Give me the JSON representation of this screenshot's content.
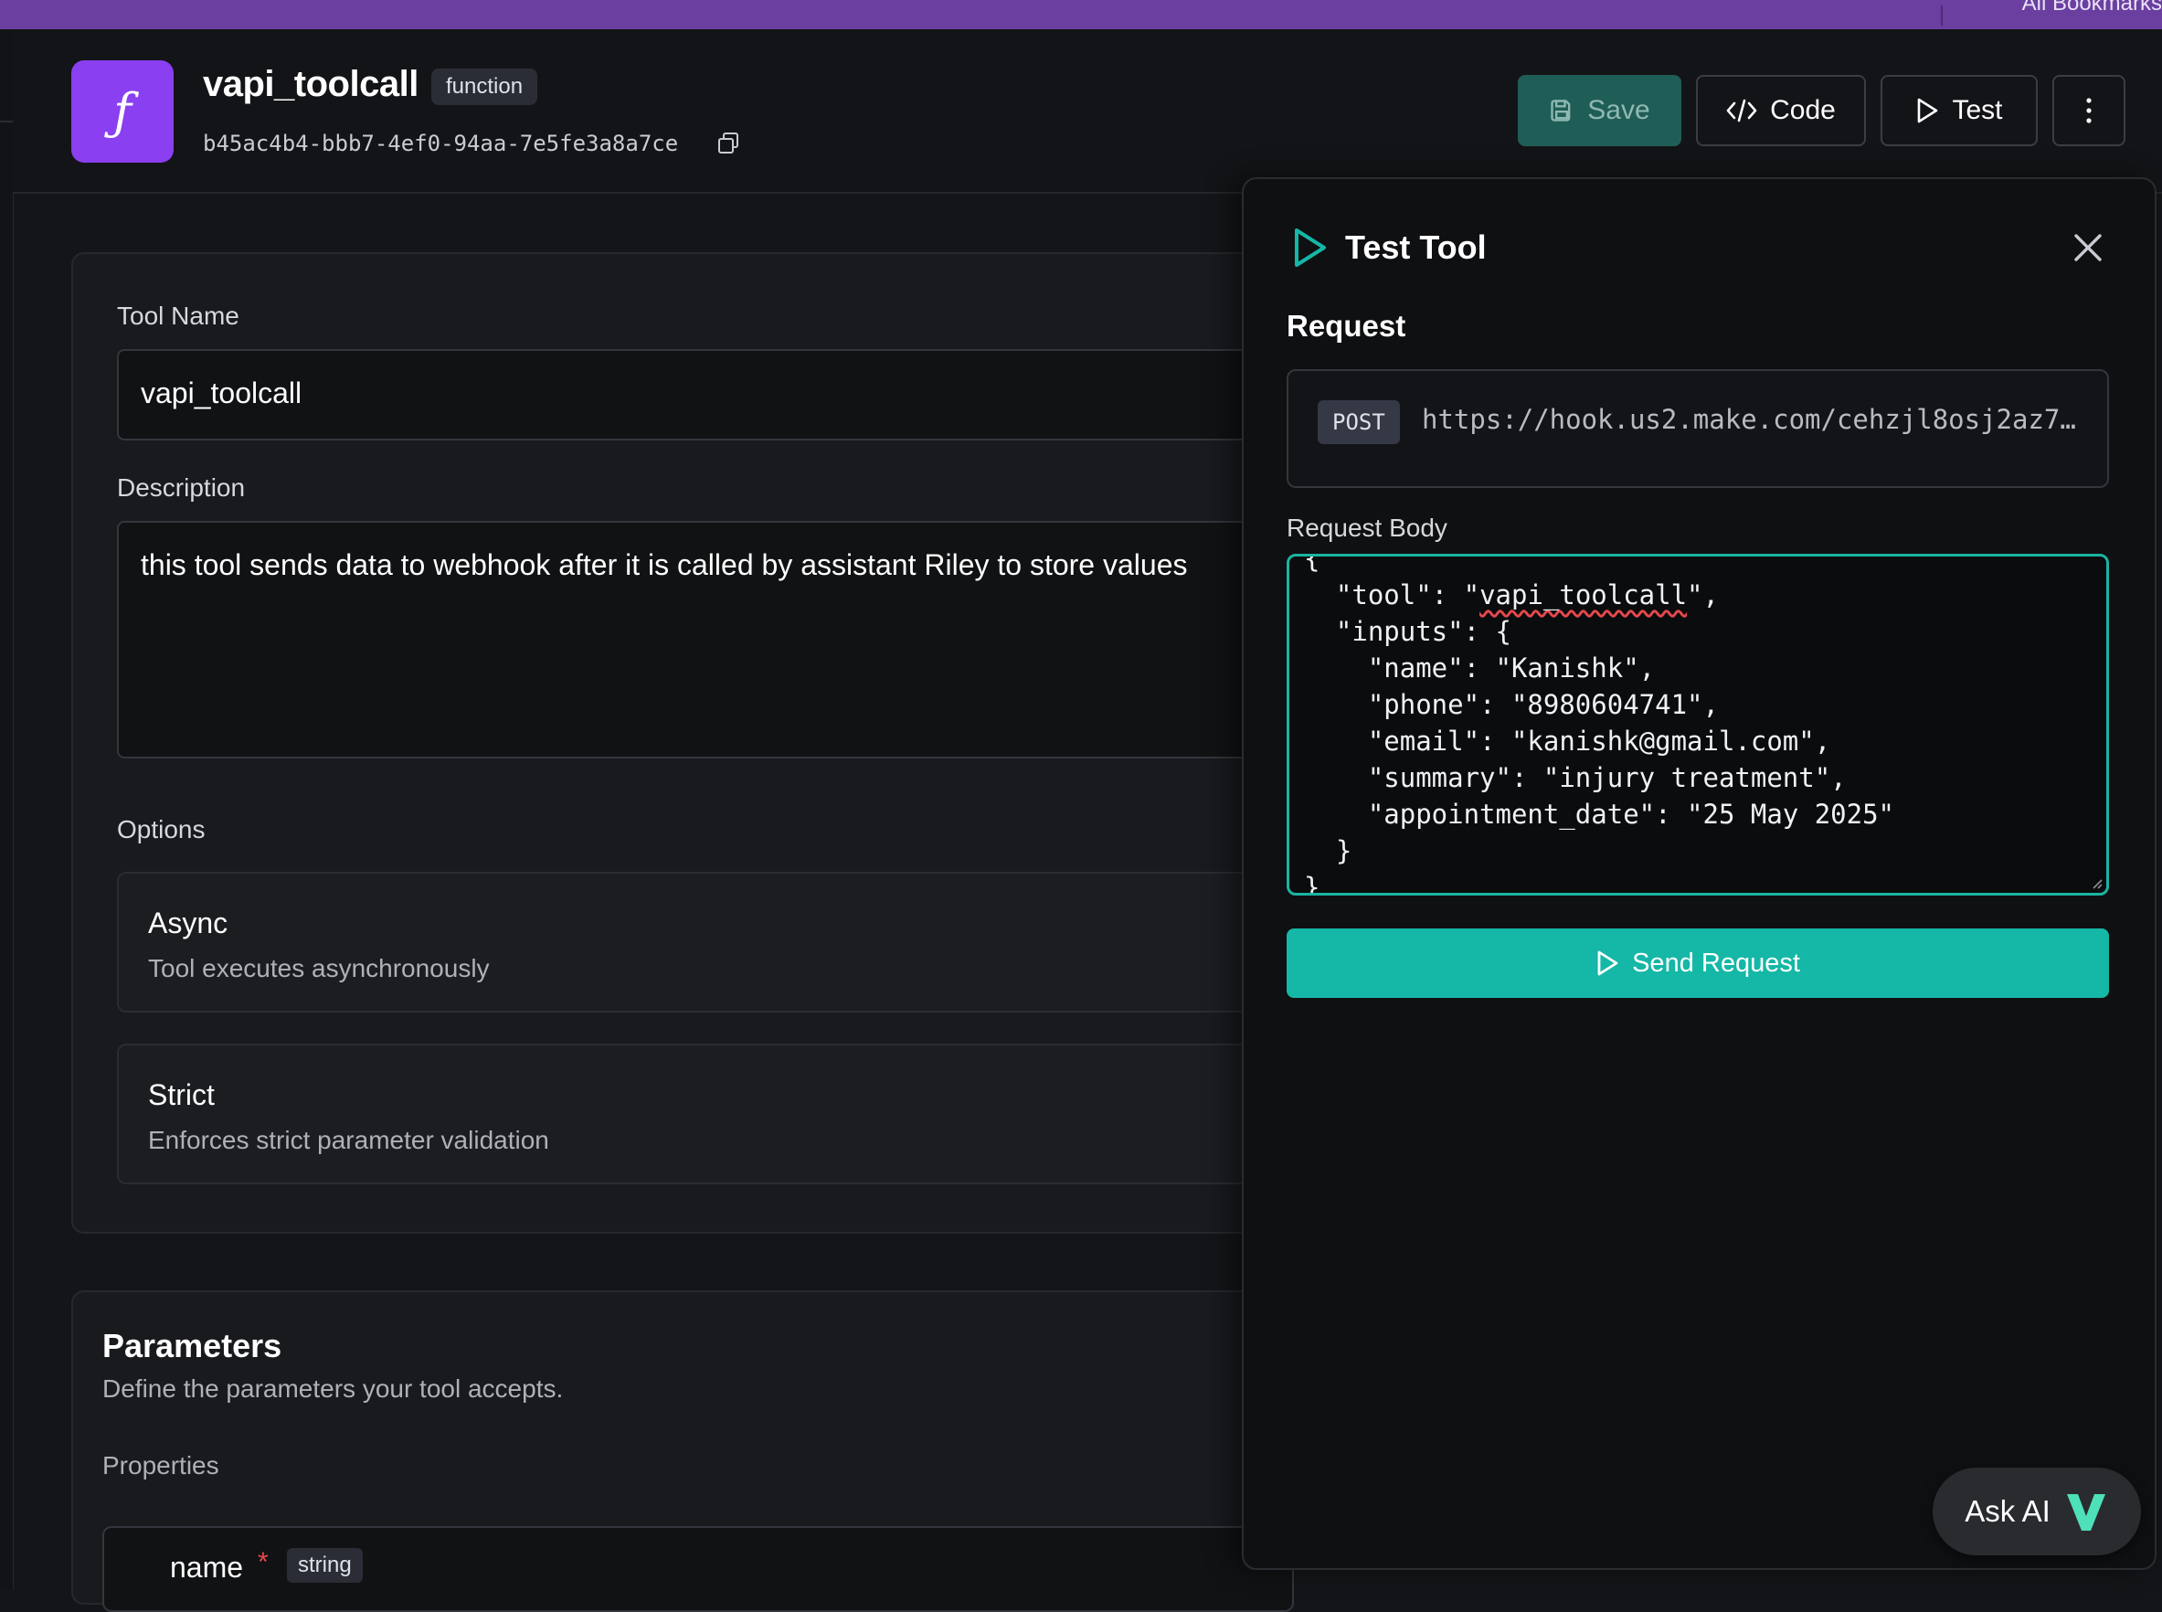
{
  "header": {
    "logo_glyph": "ƒ",
    "title": "vapi_toolcall",
    "type_badge": "function",
    "tool_id": "b45ac4b4-bbb7-4ef0-94aa-7e5fe3a8a7ce",
    "actions": {
      "save": "Save",
      "code": "Code",
      "test": "Test"
    }
  },
  "topbar": {
    "bookmarks_label": "All Bookmarks"
  },
  "form": {
    "tool_name_label": "Tool Name",
    "tool_name_value": "vapi_toolcall",
    "description_label": "Description",
    "description_value": "this tool sends data to webhook after it is called by assistant Riley to store values",
    "options_label": "Options",
    "options": [
      {
        "title": "Async",
        "description": "Tool executes asynchronously"
      },
      {
        "title": "Strict",
        "description": "Enforces strict parameter validation"
      }
    ]
  },
  "parameters": {
    "title": "Parameters",
    "subtitle": "Define the parameters your tool accepts.",
    "properties_label": "Properties",
    "rows": [
      {
        "name": "name",
        "required_marker": "*",
        "type": "string"
      }
    ]
  },
  "test_panel": {
    "title": "Test Tool",
    "request_label": "Request",
    "method": "POST",
    "url": "https://hook.us2.make.com/cehzjl8osj2az7s…",
    "body_label": "Request Body",
    "body_lines": {
      "l0": "{",
      "l1a": "  \"tool\": \"",
      "l1b": "vapi_toolcall",
      "l1c": "\",",
      "l2": "  \"inputs\": {",
      "l3": "    \"name\": \"Kanishk\",",
      "l4": "    \"phone\": \"8980604741\",",
      "l5": "    \"email\": \"kanishk@gmail.com\",",
      "l6": "    \"summary\": \"injury treatment\",",
      "l7": "    \"appointment_date\": \"25 May 2025\"",
      "l8": "  }",
      "l9": "}"
    },
    "send_label": "Send Request"
  },
  "ask_ai": {
    "label": "Ask AI"
  },
  "colors": {
    "accent_teal": "#15b7a6",
    "logo_purple": "#8a3ff0",
    "topbar_purple": "#6a3fa0",
    "required_red": "#e5484d"
  },
  "icons": [
    "function-icon",
    "copy-icon",
    "save-icon",
    "code-icon",
    "play-icon",
    "more-vertical-icon",
    "close-icon",
    "vapi-logo-icon"
  ]
}
